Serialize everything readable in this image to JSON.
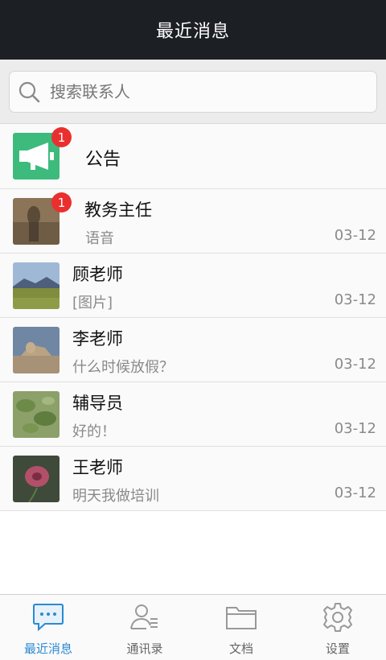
{
  "header": {
    "title": "最近消息"
  },
  "search": {
    "placeholder": "搜索联系人"
  },
  "announcement": {
    "label": "公告",
    "badge": "1",
    "icon": "megaphone-icon",
    "color": "#3dbb7c"
  },
  "messages": [
    {
      "name": "教务主任",
      "preview": "语音",
      "date": "03-12",
      "badge": "1"
    },
    {
      "name": "顾老师",
      "preview": "[图片]",
      "date": "03-12"
    },
    {
      "name": "李老师",
      "preview": "什么时候放假？",
      "date": "03-12"
    },
    {
      "name": "辅导员",
      "preview": "好的！",
      "date": "03-12"
    },
    {
      "name": "王老师",
      "preview": "明天我做培训",
      "date": "03-12"
    }
  ],
  "tabs": [
    {
      "label": "最近消息",
      "icon": "chat-bubble-icon",
      "active": true
    },
    {
      "label": "通讯录",
      "icon": "contacts-icon"
    },
    {
      "label": "文档",
      "icon": "folder-icon"
    },
    {
      "label": "设置",
      "icon": "gear-icon"
    }
  ],
  "colors": {
    "header": "#1c1f24",
    "accent": "#2a8ad3",
    "badge": "#e9302e",
    "announce": "#3dbb7c"
  }
}
